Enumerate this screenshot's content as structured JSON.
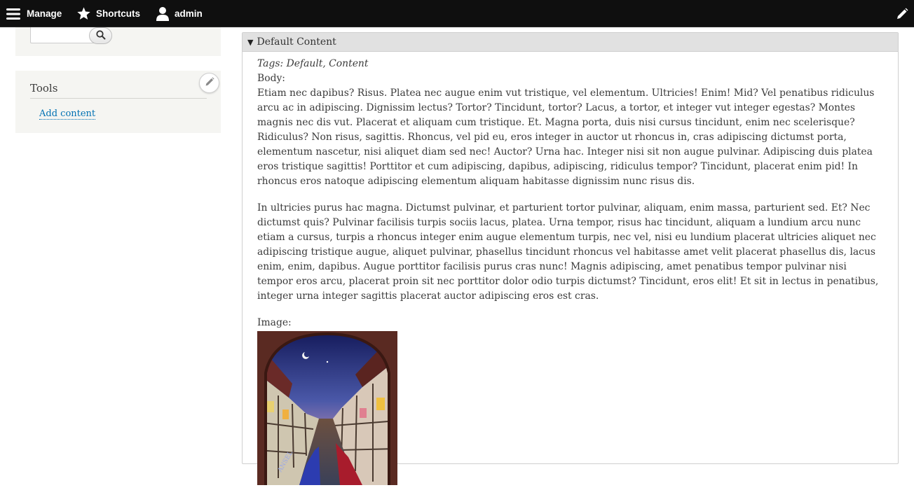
{
  "toolbar": {
    "manage_label": "Manage",
    "shortcuts_label": "Shortcuts",
    "user_label": "admin"
  },
  "sidebar": {
    "search": {
      "placeholder": "",
      "value": ""
    },
    "tools": {
      "title": "Tools",
      "link": "Add content"
    }
  },
  "content": {
    "summary": "Default Content",
    "tags_prefix": "Tags:",
    "tags": "Default, Content",
    "body_label": "Body:",
    "paragraphs": [
      "Etiam nec dapibus? Risus. Platea nec augue enim vut tristique, vel elementum. Ultricies! Enim! Mid? Vel penatibus ridiculus arcu ac in adipiscing. Dignissim lectus? Tortor? Tincidunt, tortor? Lacus, a tortor, et integer vut integer egestas? Montes magnis nec dis vut. Placerat et aliquam cum tristique. Et. Magna porta, duis nisi cursus tincidunt, enim nec scelerisque? Ridiculus? Non risus, sagittis. Rhoncus, vel pid eu, eros integer in auctor ut rhoncus in, cras adipiscing dictumst porta, elementum nascetur, nisi aliquet diam sed nec! Auctor? Urna hac. Integer nisi sit non augue pulvinar. Adipiscing duis platea eros tristique sagittis! Porttitor et cum adipiscing, dapibus, adipiscing, ridiculus tempor? Tincidunt, placerat enim pid! In rhoncus eros natoque adipiscing elementum aliquam habitasse dignissim nunc risus dis.",
      "In ultricies purus hac magna. Dictumst pulvinar, et parturient tortor pulvinar, aliquam, enim massa, parturient sed. Et? Nec dictumst quis? Pulvinar facilisis turpis sociis lacus, platea. Urna tempor, risus hac tincidunt, aliquam a lundium arcu nunc etiam a cursus, turpis a rhoncus integer enim augue elementum turpis, nec vel, nisi eu lundium placerat ultricies aliquet nec adipiscing tristique augue, aliquet pulvinar, phasellus tincidunt rhoncus vel habitasse amet velit placerat phasellus dis, lacus enim, enim, dapibus. Augue porttitor facilisis purus cras nunc! Magnis adipiscing, amet penatibus tempor pulvinar nisi tempor eros arcu, placerat proin sit nec porttitor dolor odio turpis dictumst? Tincidunt, eros elit! Et sit in lectus in penatibus, integer urna integer sagittis placerat auctor adipiscing eros est cras."
    ],
    "image_label": "Image:",
    "image_watermark": "ANSEL"
  },
  "colors": {
    "toolbar_bg": "#0f0f0f",
    "sidebar_bg": "#f5f5f2",
    "link": "#0071b3",
    "summary_bg": "#e1e1e1"
  },
  "icons": {
    "manage": "hamburger-icon",
    "shortcuts": "star-icon",
    "user": "user-icon",
    "edit": "pencil-icon",
    "search": "search-icon"
  }
}
